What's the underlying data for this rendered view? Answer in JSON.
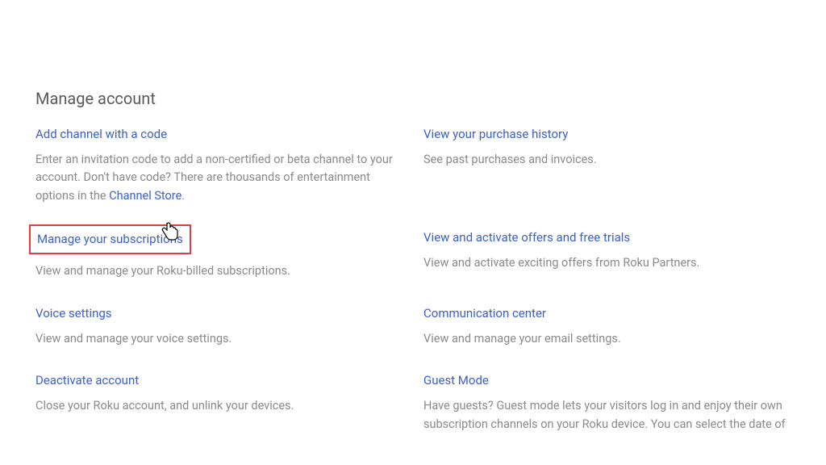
{
  "page": {
    "title": "Manage account"
  },
  "items": {
    "left": [
      {
        "title": "Add channel with a code",
        "desc_pre": "Enter an invitation code to add a non-certified or beta channel to your account. Don't have code? There are thousands of entertainment options in the ",
        "desc_link": "Channel Store",
        "desc_post": "."
      },
      {
        "title": "Manage your subscriptions",
        "desc": "View and manage your Roku-billed subscriptions."
      },
      {
        "title": "Voice settings",
        "desc": "View and manage your voice settings."
      },
      {
        "title": "Deactivate account",
        "desc": "Close your Roku account, and unlink your devices."
      }
    ],
    "right": [
      {
        "title": "View your purchase history",
        "desc": "See past purchases and invoices."
      },
      {
        "title": "View and activate offers and free trials",
        "desc": "View and activate exciting offers from Roku Partners."
      },
      {
        "title": "Communication center",
        "desc": "View and manage your email settings."
      },
      {
        "title": "Guest Mode",
        "desc": "Have guests? Guest mode lets your visitors log in and enjoy their own subscription channels on your Roku device. You can select the date of"
      }
    ]
  }
}
